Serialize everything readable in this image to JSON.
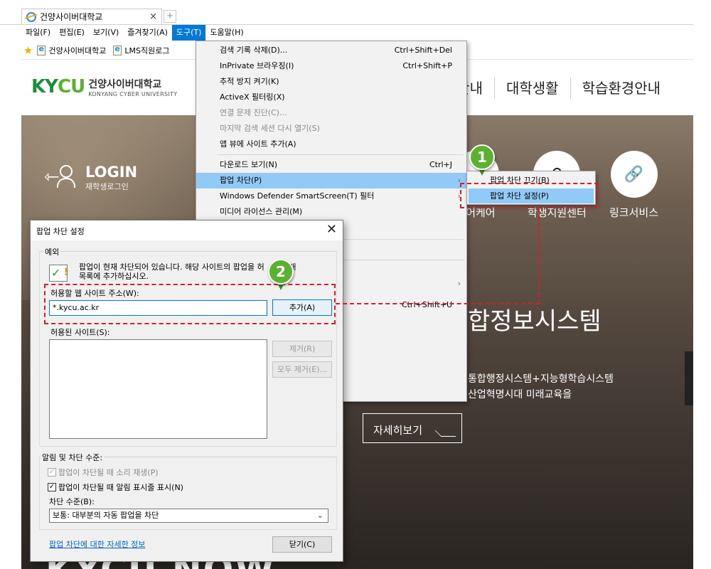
{
  "browser": {
    "tab_title": "건양사이버대학교",
    "tab_close": "×",
    "new_tab": "+",
    "menu": [
      "파일(F)",
      "편집(E)",
      "보기(V)",
      "즐겨찾기(A)",
      "도구(T)",
      "도움말(H)"
    ],
    "favorites": [
      "건양사이버대학교",
      "LMS직원로그"
    ]
  },
  "site": {
    "logo_mark_a": "KY",
    "logo_mark_b": "CU",
    "logo_korean": "건양사이버대학교",
    "logo_english": "KONYANG CYBER UNIVERSITY",
    "nav": [
      "안내",
      "대학생활",
      "학습환경안내"
    ],
    "login_title": "LOGIN",
    "login_sub": "재학생로그인",
    "quick": [
      {
        "label": "디어케어",
        "icon": "media-care-icon"
      },
      {
        "label": "학생지원센터",
        "icon": "search-icon"
      },
      {
        "label": "링크서비스",
        "icon": "link-icon"
      }
    ],
    "hero_title": "합정보시스템",
    "hero_sub_1": "통합행정시스템+지능형학습시스템",
    "hero_sub_2": "산업혁명시대 미래교육을",
    "more_button": "자세히보기",
    "banner_text": "KYCU NOW"
  },
  "tools_menu": {
    "items": [
      {
        "label": "검색 기록 삭제(D)...",
        "shortcut": "Ctrl+Shift+Del"
      },
      {
        "label": "InPrivate 브라우징(I)",
        "shortcut": "Ctrl+Shift+P"
      },
      {
        "label": "추적 방지 켜기(K)",
        "shortcut": ""
      },
      {
        "label": "ActiveX 필터링(X)",
        "shortcut": ""
      },
      {
        "label": "연결 문제 진단(C)...",
        "shortcut": ""
      },
      {
        "label": "마지막 검색 세션 다시 열기(S)",
        "shortcut": ""
      },
      {
        "label": "앱 뷰에 사이트 추가(A)",
        "shortcut": ""
      },
      {
        "label": "다운로드 보기(N)",
        "shortcut": "Ctrl+J"
      },
      {
        "label": "팝업 차단(P)",
        "shortcut": ""
      },
      {
        "label": "Windows Defender SmartScreen(T) 필터",
        "shortcut": ""
      },
      {
        "label": "미디어 라이선스 관리(M)",
        "shortcut": ""
      },
      {
        "label": "",
        "shortcut": "Ctrl+Shift+U"
      }
    ],
    "arrow": "›"
  },
  "popup_submenu": {
    "items": [
      "팝업 차단 끄기(B)",
      "팝업 차단 설정(P)"
    ]
  },
  "dialog": {
    "title": "팝업 차단 설정",
    "close": "✕",
    "exceptions_group": "예외",
    "info_line_1": "팝업이 현재 차단되어 있습니다. 해당 사이트의 팝업을 허",
    "info_line_1b": "아래",
    "info_line_2": "목록에 추가하십시오.",
    "address_label": "허용할 웹 사이트 주소(W):",
    "address_value": "*.kycu.ac.kr",
    "add_button": "추가(A)",
    "allowed_label": "허용된 사이트(S):",
    "remove_button": "제거(R)",
    "remove_all_button": "모두 제거(E)...",
    "notify_group": "알림 및 차단 수준:",
    "check_sound": "팝업이 차단될 때 소리 재생(P)",
    "check_notify": "팝업이 차단될 때 알림 표시줄 표시(N)",
    "level_label": "차단 수준(B):",
    "level_value": "보통: 대부분의 자동 팝업을 차단",
    "info_link": "팝업 차단에 대한 자세한 정보",
    "close_button": "닫기(C)"
  },
  "annotations": {
    "pin_1": "1",
    "pin_2": "2",
    "color": "#d21f2b",
    "pin_color": "#5bb130"
  },
  "colors": {
    "menu_active": "#0078d7",
    "menu_highlight": "#91c9f7",
    "logo_green": "#1d8f3a"
  }
}
